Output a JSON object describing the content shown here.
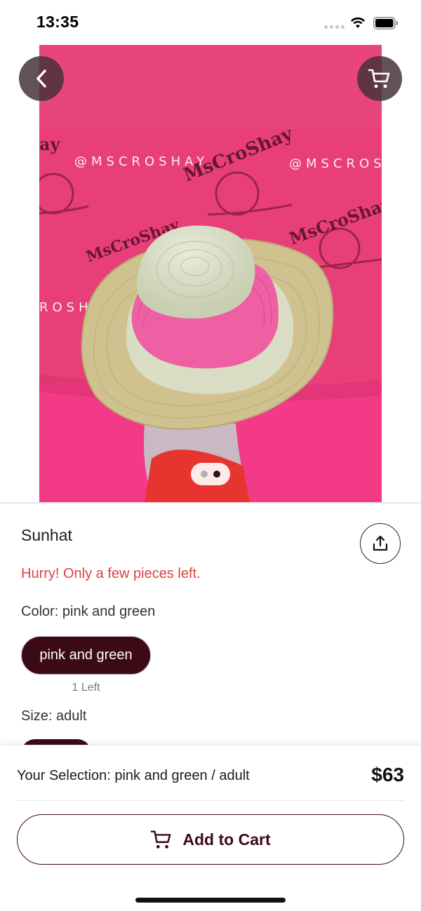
{
  "status_bar": {
    "time": "13:35"
  },
  "product": {
    "title": "Sunhat",
    "stock_message": "Hurry! Only a few pieces left.",
    "color_label": "Color: pink and green",
    "color_option": "pink and green",
    "color_option_stock": "1 Left",
    "size_label": "Size: adult"
  },
  "gallery": {
    "image_count": 2,
    "active_index": 1
  },
  "selection": {
    "text": "Your Selection: pink and green / adult",
    "price": "$63"
  },
  "actions": {
    "add_to_cart_label": "Add to Cart"
  },
  "colors": {
    "accent": "#3b0a16",
    "warning": "#d9443f",
    "photo_background": "#e83e76"
  },
  "icons": [
    "back-icon",
    "cart-icon",
    "share-icon",
    "wifi-icon",
    "battery-icon"
  ]
}
